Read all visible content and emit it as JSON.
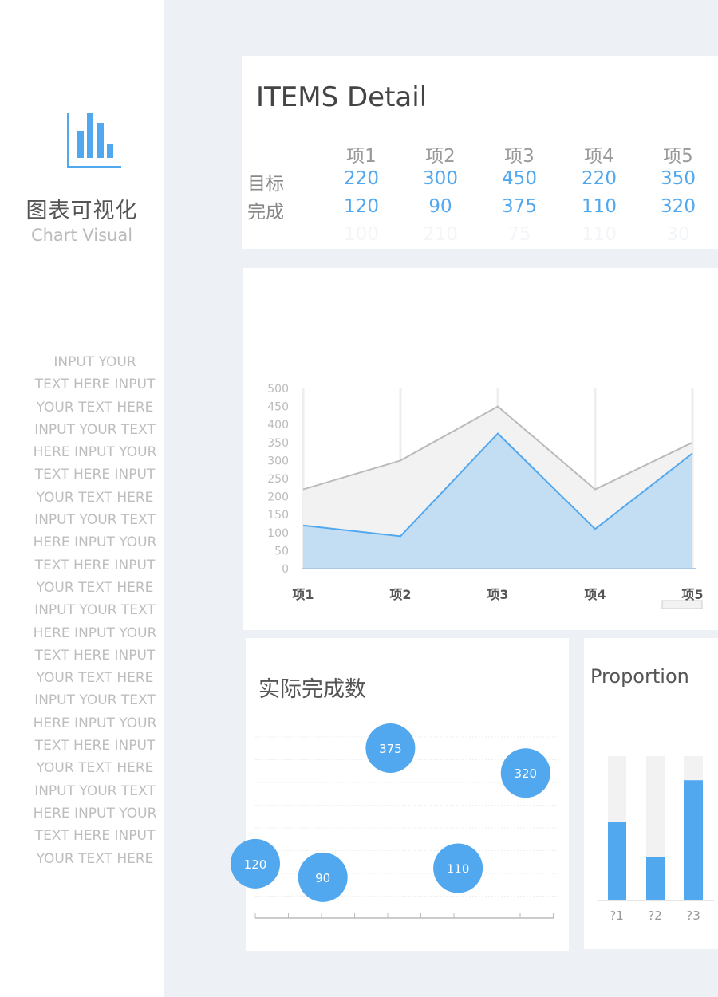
{
  "sidebar": {
    "title_cn": "图表可视化",
    "title_en": "Chart Visual",
    "icon": "bar-chart-icon",
    "filler": [
      "INPUT YOUR",
      "TEXT HERE INPUT",
      "YOUR TEXT HERE",
      "INPUT YOUR TEXT",
      "HERE INPUT YOUR",
      "TEXT HERE INPUT",
      "YOUR TEXT HERE",
      "INPUT YOUR TEXT",
      "HERE INPUT YOUR",
      "TEXT HERE INPUT",
      "YOUR TEXT HERE",
      "INPUT YOUR TEXT",
      "HERE INPUT YOUR",
      "TEXT HERE INPUT",
      "YOUR TEXT HERE",
      "INPUT YOUR TEXT",
      "HERE INPUT YOUR",
      "TEXT HERE INPUT",
      "YOUR TEXT HERE",
      "INPUT YOUR TEXT",
      "HERE INPUT YOUR",
      "TEXT HERE INPUT",
      "YOUR TEXT HERE"
    ]
  },
  "detail": {
    "title": "ITEMS Detail",
    "columns": [
      "项1",
      "项2",
      "项3",
      "项4",
      "项5"
    ],
    "rows": [
      {
        "label": "目标",
        "values": [
          "220",
          "300",
          "450",
          "220",
          "350"
        ]
      },
      {
        "label": "完成",
        "values": [
          "120",
          "90",
          "375",
          "110",
          "320"
        ]
      },
      {
        "label": "",
        "values": [
          "100",
          "210",
          "75",
          "110",
          "30"
        ]
      }
    ]
  },
  "colors": {
    "accent": "#52a8ee",
    "area_fill": "#c3ddf3",
    "target_fill": "#f2f2f2",
    "target_line": "#bbbbbb"
  },
  "chart_data": [
    {
      "type": "area",
      "categories": [
        "项1",
        "项2",
        "项3",
        "项4",
        "项5"
      ],
      "ylim": [
        0,
        500
      ],
      "yticks": [
        0,
        50,
        100,
        150,
        200,
        250,
        300,
        350,
        400,
        450,
        500
      ],
      "series": [
        {
          "values": [
            220,
            300,
            450,
            220,
            350
          ]
        },
        {
          "values": [
            120,
            90,
            375,
            110,
            320
          ]
        }
      ]
    },
    {
      "type": "scatter",
      "title": "实际完成数",
      "values": [
        120,
        90,
        375,
        110,
        320
      ]
    },
    {
      "type": "bar",
      "title": "Proportion",
      "categories": [
        "?1",
        "?2",
        "?3"
      ],
      "values": [
        0.545,
        0.3,
        0.833
      ]
    }
  ]
}
